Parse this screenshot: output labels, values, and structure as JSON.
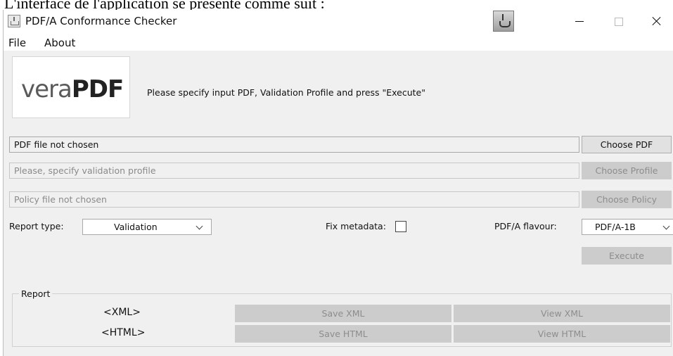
{
  "caption": "L'interface de l'application se présente comme suit :",
  "window": {
    "title": "PDF/A Conformance Checker"
  },
  "icons": {
    "app": "app-window-icon",
    "java": "java-coffee-cup-icon",
    "minimize": "minimize-icon",
    "maximize": "maximize-icon",
    "close": "close-icon",
    "dropdown": "chevron-down-icon"
  },
  "menu": {
    "file": "File",
    "about": "About"
  },
  "logo": {
    "light": "vera",
    "bold": "PDF"
  },
  "instruction": "Please specify input PDF, Validation Profile and press \"Execute\"",
  "inputs": {
    "pdf": {
      "value": "PDF file not chosen",
      "button": "Choose PDF"
    },
    "profile": {
      "value": "Please, specify validation profile",
      "button": "Choose Profile"
    },
    "policy": {
      "value": "Policy file not chosen",
      "button": "Choose Policy"
    }
  },
  "options": {
    "report_type_label": "Report type:",
    "report_type_value": "Validation",
    "fix_metadata_label": "Fix metadata:",
    "fix_metadata_checked": false,
    "flavour_label": "PDF/A flavour:",
    "flavour_value": "PDF/A-1B"
  },
  "execute_button": "Execute",
  "report": {
    "legend": "Report",
    "xml_label": "<XML>",
    "html_label": "<HTML>",
    "save_xml": "Save XML",
    "view_xml": "View XML",
    "save_html": "Save HTML",
    "view_html": "View HTML"
  }
}
